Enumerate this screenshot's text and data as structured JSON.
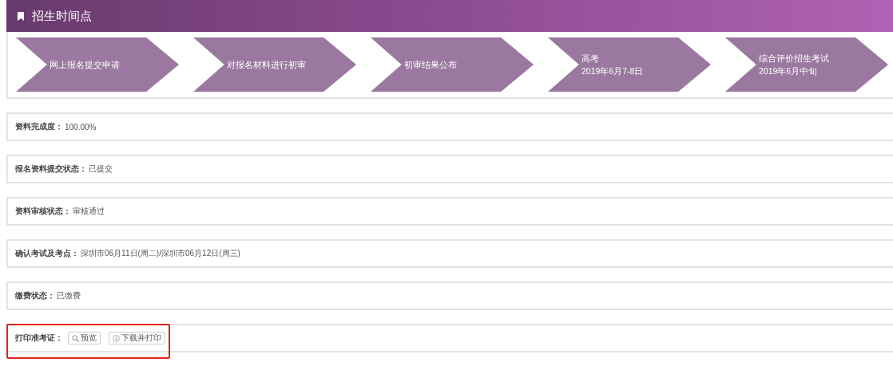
{
  "header": {
    "title": "招生时间点"
  },
  "steps": [
    {
      "title": "网上报名提交申请"
    },
    {
      "title": "对报名材料进行初审"
    },
    {
      "title": "初审结果公布"
    },
    {
      "title": "高考",
      "date": "2019年6月7-8日"
    },
    {
      "title": "综合评价招生考试",
      "date": "2019年6月中旬"
    }
  ],
  "rows": [
    {
      "kind": "text",
      "label": "资料完成度：",
      "value": "100.00%",
      "highlighted": false
    },
    {
      "kind": "text",
      "label": "报名资料提交状态：",
      "value": "已提交",
      "highlighted": false
    },
    {
      "kind": "text",
      "label": "资料审核状态：",
      "value": "审核通过",
      "highlighted": false
    },
    {
      "kind": "text",
      "label": "确认考试及考点：",
      "value": "深圳市06月11日(周二)/深圳市06月12日(周三)",
      "highlighted": false
    },
    {
      "kind": "text",
      "label": "缴费状态：",
      "value": "已缴费",
      "highlighted": false
    },
    {
      "kind": "actions",
      "label": "打印准考证：",
      "buttons": [
        {
          "kind": "preview",
          "label": "预览"
        },
        {
          "kind": "download",
          "label": "下载并打印"
        }
      ],
      "highlighted": true
    }
  ]
}
